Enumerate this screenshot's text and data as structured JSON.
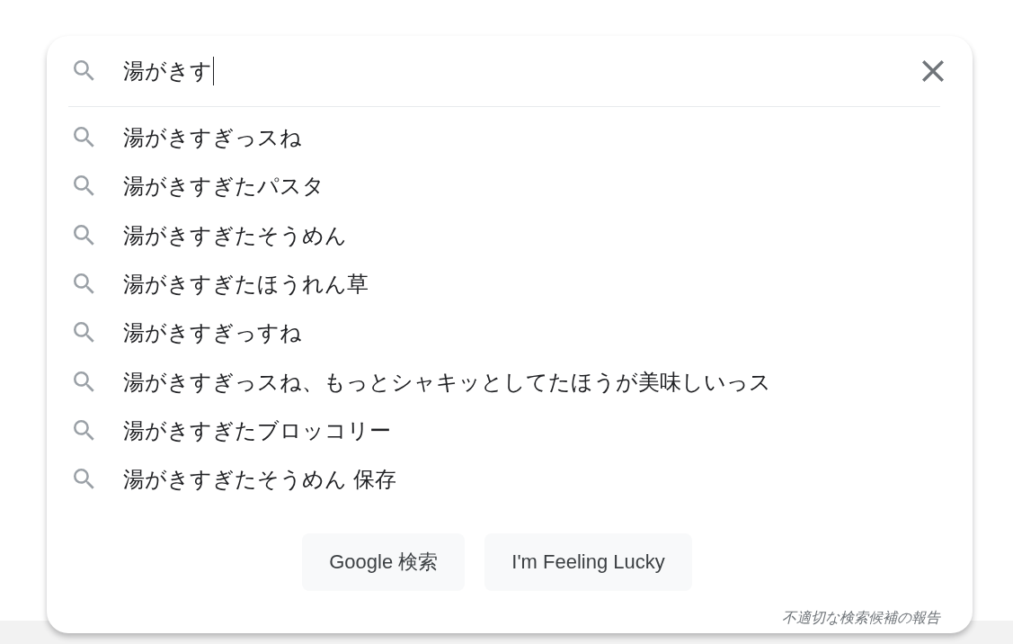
{
  "search": {
    "value": "湯がきす"
  },
  "suggestions": [
    {
      "text": "湯がきすぎっスね"
    },
    {
      "text": "湯がきすぎたパスタ"
    },
    {
      "text": "湯がきすぎたそうめん"
    },
    {
      "text": "湯がきすぎたほうれん草"
    },
    {
      "text": "湯がきすぎっすね"
    },
    {
      "text": "湯がきすぎっスね、もっとシャキッとしてたほうが美味しいっス"
    },
    {
      "text": "湯がきすぎたブロッコリー"
    },
    {
      "text": "湯がきすぎたそうめん 保存"
    }
  ],
  "buttons": [
    "Google 検索",
    "I'm Feeling Lucky"
  ],
  "report_link": "不適切な検索候補の報告"
}
